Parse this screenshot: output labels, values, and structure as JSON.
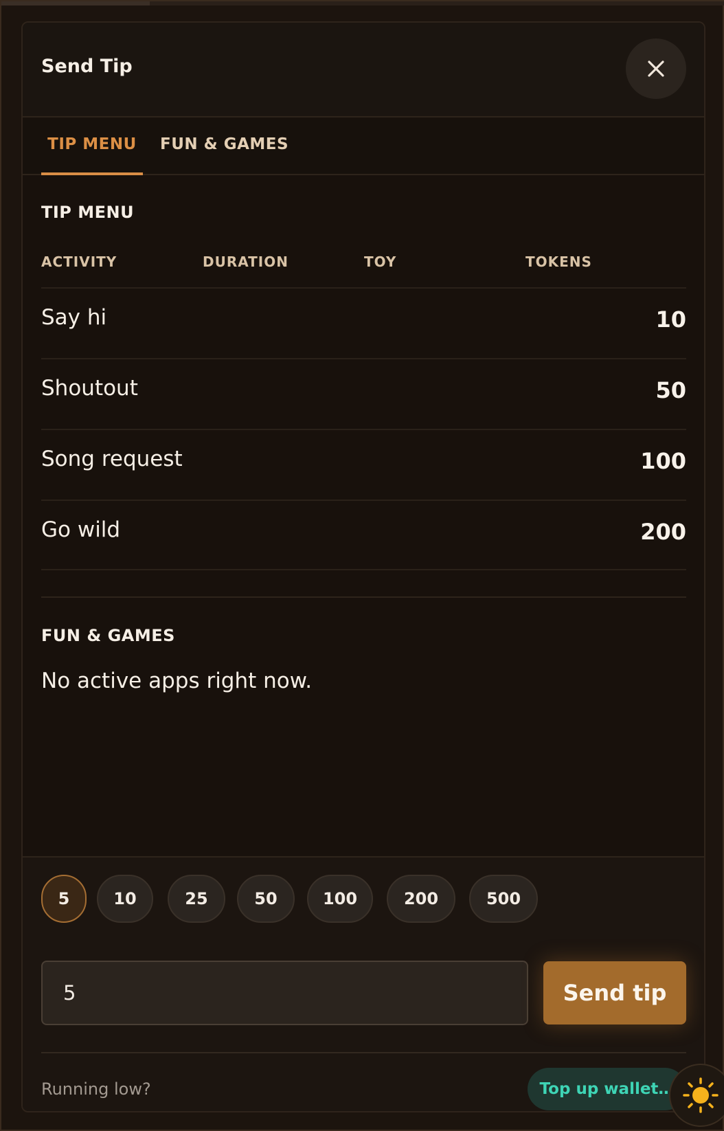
{
  "modal": {
    "title": "Send Tip"
  },
  "tabs": [
    {
      "label": "TIP MENU",
      "active": true
    },
    {
      "label": "FUN & GAMES",
      "active": false
    }
  ],
  "tip_menu": {
    "heading": "TIP MENU",
    "columns": [
      "ACTIVITY",
      "DURATION",
      "TOY",
      "TOKENS"
    ],
    "rows": [
      {
        "activity": "Say hi",
        "tokens": "10"
      },
      {
        "activity": "Shoutout",
        "tokens": "50"
      },
      {
        "activity": "Song request",
        "tokens": "100"
      },
      {
        "activity": "Go wild",
        "tokens": "200"
      }
    ]
  },
  "fun_games": {
    "heading": "FUN & GAMES",
    "empty_message": "No active apps right now."
  },
  "footer": {
    "chips": [
      "5",
      "10",
      "25",
      "50",
      "100",
      "200",
      "500"
    ],
    "selected_chip": "5",
    "amount_value": "5",
    "send_label": "Send tip",
    "low_text": "Running low?",
    "topup_label": "Top up wallet…"
  },
  "colors": {
    "accent": "#d98e46",
    "send_button": "#a36b2c",
    "topup_text": "#3ed4b5",
    "background": "#18110c"
  },
  "icons": {
    "close": "close-icon",
    "theme": "sun-icon"
  }
}
